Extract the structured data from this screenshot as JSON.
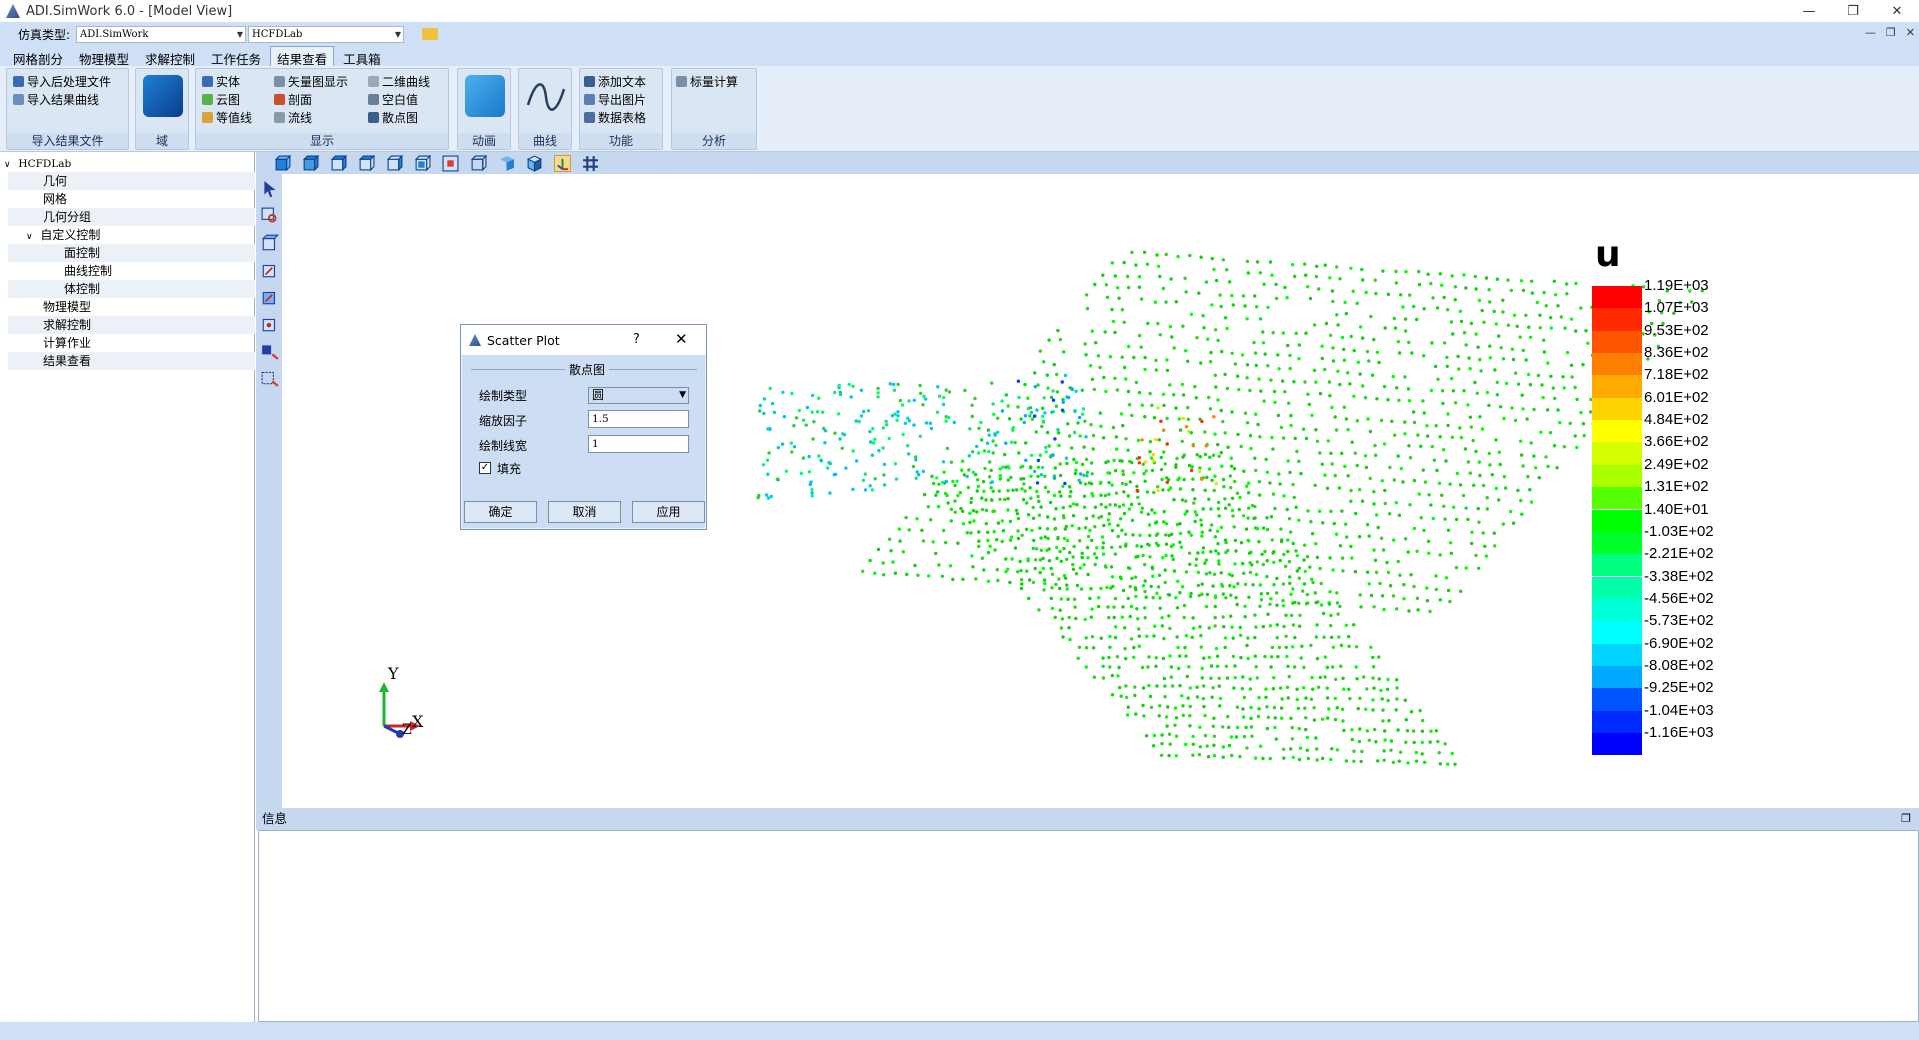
{
  "window": {
    "title": "ADI.SimWork 6.0 - [Model View]",
    "minimize": "—",
    "restore": "❐",
    "close": "✕"
  },
  "typebar": {
    "label": "仿真类型:",
    "sim_type": "ADI.SimWork",
    "solver": "HCFDLab"
  },
  "tabs": [
    "网格剖分",
    "物理模型",
    "求解控制",
    "工作任务",
    "结果查看",
    "工具箱"
  ],
  "active_tab": "结果查看",
  "ribbon": {
    "import_group": {
      "title": "导入结果文件",
      "items": [
        "导入后处理文件",
        "导入结果曲线"
      ]
    },
    "domain_group": {
      "title": "域"
    },
    "display_group": {
      "title": "显示",
      "col1": [
        "实体",
        "云图",
        "等值线"
      ],
      "col2": [
        "矢量图显示",
        "剖面",
        "流线"
      ],
      "col3": [
        "二维曲线",
        "空白值",
        "散点图"
      ]
    },
    "animation_group": {
      "title": "动画"
    },
    "curve_group": {
      "title": "曲线"
    },
    "function_group": {
      "title": "功能",
      "items": [
        "添加文本",
        "导出图片",
        "数据表格"
      ]
    },
    "analysis_group": {
      "title": "分析",
      "items": [
        "标量计算"
      ]
    }
  },
  "tree": {
    "root": "HCFDLab",
    "items": [
      "几何",
      "网格",
      "几何分组",
      "自定义控制",
      "面控制",
      "曲线控制",
      "体控制",
      "物理模型",
      "求解控制",
      "计算作业",
      "结果查看"
    ]
  },
  "dialog": {
    "title": "Scatter Plot",
    "help": "?",
    "close": "✕",
    "group_title": "散点图",
    "plot_type_label": "绘制类型",
    "plot_type_value": "圆",
    "scale_label": "缩放因子",
    "scale_value": "1.5",
    "linewidth_label": "绘制线宽",
    "linewidth_value": "1",
    "fill_label": "填充",
    "fill_checked": true,
    "ok": "确定",
    "cancel": "取消",
    "apply": "应用"
  },
  "legend": {
    "title": "u",
    "labels": [
      "1.19E+03",
      "1.07E+03",
      "9.53E+02",
      "8.36E+02",
      "7.18E+02",
      "6.01E+02",
      "4.84E+02",
      "3.66E+02",
      "2.49E+02",
      "1.31E+02",
      "1.40E+01",
      "-1.03E+02",
      "-2.21E+02",
      "-3.38E+02",
      "-4.56E+02",
      "-5.73E+02",
      "-6.90E+02",
      "-8.08E+02",
      "-9.25E+02",
      "-1.04E+03",
      "-1.16E+03"
    ],
    "colors": [
      "#ff0000",
      "#ff2a00",
      "#ff5500",
      "#ff8000",
      "#ffaa00",
      "#ffd400",
      "#ffff00",
      "#d4ff00",
      "#aaff00",
      "#55ff00",
      "#00ff00",
      "#00ff2a",
      "#00ff80",
      "#00ffaa",
      "#00ffd4",
      "#00ffff",
      "#00d4ff",
      "#00aaff",
      "#0055ff",
      "#002aff",
      "#0000ff"
    ]
  },
  "axes": {
    "y": "Y",
    "x": "X",
    "z": "Z"
  },
  "info_panel": {
    "title": "信息"
  }
}
